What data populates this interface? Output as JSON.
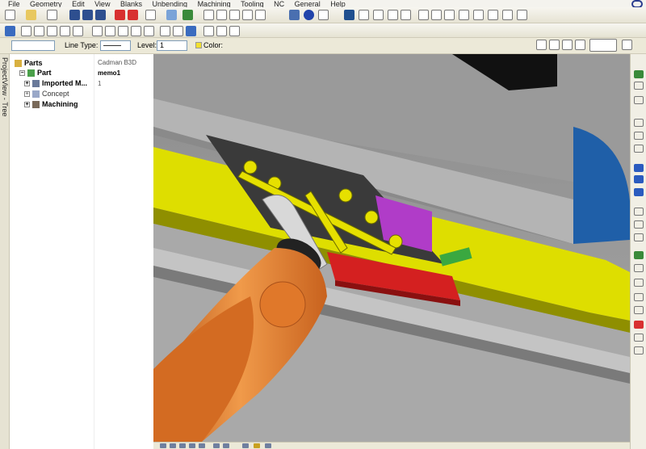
{
  "menu": [
    "File",
    "Geometry",
    "Edit",
    "View",
    "Blanks",
    "Unbending",
    "Machining",
    "Tooling",
    "NC",
    "General",
    "Help"
  ],
  "toolbar3": {
    "line_type_label": "Line Type:",
    "level_label": "Level:",
    "level_value": "1",
    "color_label": "Color:"
  },
  "side_panel": {
    "title": "ProjectView - Tree"
  },
  "tree": {
    "parts": "Parts",
    "part": "Part",
    "imported": "Imported M...",
    "concept": "Concept",
    "machining": "Machining"
  },
  "props": {
    "line1": "Cadman B3D",
    "line2": "memo1",
    "line3": "1"
  },
  "colors": {
    "accent_blue": "#2a5bbf",
    "robot_orange": "#e0782a",
    "fixture_yellow": "#e8e800",
    "part_red": "#d42020",
    "magenta": "#b03cc8"
  }
}
